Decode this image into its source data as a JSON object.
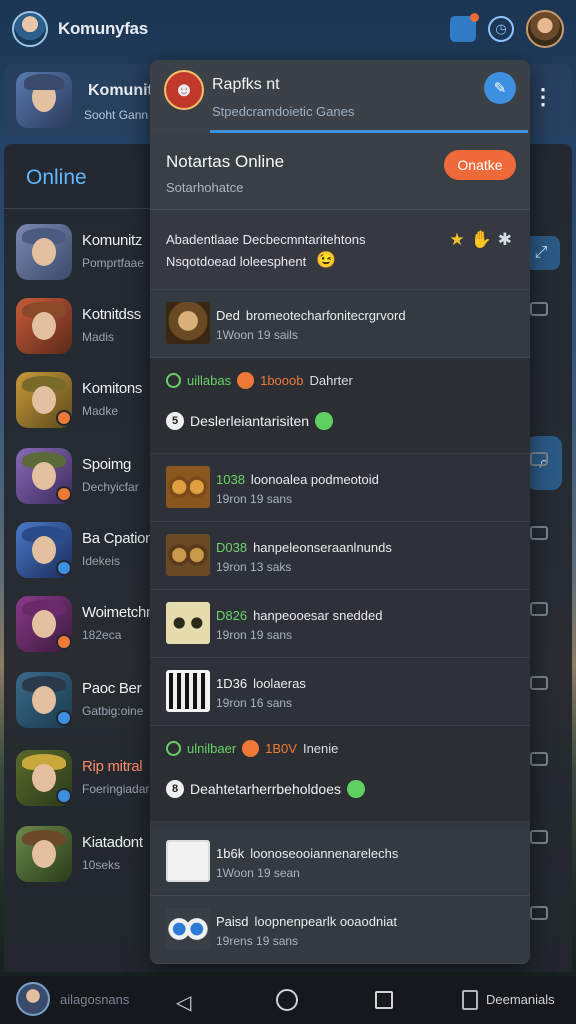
{
  "app": {
    "title": "Komunyfas"
  },
  "community": {
    "title": "Komunit",
    "subtitle": "Sooht Gann"
  },
  "sidebar": {
    "section_label": "Online",
    "items": [
      {
        "name": "Komunitz",
        "sub": "Pomprtfaae"
      },
      {
        "name": "Kotnitdss",
        "sub": "Madis"
      },
      {
        "name": "Komitons",
        "sub": "Madke"
      },
      {
        "name": "Spoimg",
        "sub": "Dechyicfar"
      },
      {
        "name": "Ba Cpation",
        "sub": "Idekeis"
      },
      {
        "name": "Woimetchn",
        "sub": "182eca"
      },
      {
        "name": "Paoc Ber",
        "sub": "Gatbig:oine"
      },
      {
        "name": "Rip mitral",
        "sub": "Foeringiadar"
      },
      {
        "name": "Kiatadont",
        "sub": "10seks"
      }
    ]
  },
  "dropdown": {
    "title": "Rapfks nt",
    "subtitle": "Stpedcramdoietic Ganes",
    "notification": {
      "title": "Notartas Online",
      "subtitle": "Sotarhohatce",
      "button_label": "Onatke"
    },
    "announcement": {
      "line1": "Abadentlaae Decbecmntaritehtons",
      "line2": "Nsqotdoead loleesphent",
      "emoji": "😉"
    },
    "feed": [
      {
        "tag": "Ded",
        "title": "bromeotecharfonitecrgrvord",
        "meta": "1Woon 19 sails",
        "thumb": "a"
      },
      {
        "tag": "1038",
        "title": "loonoalea podmeotoid",
        "meta": "19ron 19 sans",
        "thumb": "b"
      },
      {
        "tag": "D038",
        "title": "hanpeleonseraanlnunds",
        "meta": "19ron 13 saks",
        "thumb": "c"
      },
      {
        "tag": "D826",
        "title": "hanpeooesar snedded",
        "meta": "19ron 19 sans",
        "thumb": "d"
      },
      {
        "tag": "1D36",
        "title": "loolaeras",
        "meta": "19ron 16 sans",
        "thumb": "e"
      },
      {
        "tag": "1b6k",
        "title": "loonoseooiannenarelechs",
        "meta": "1Woon 19 sean",
        "thumb": "f"
      },
      {
        "tag": "Paisd",
        "title": "loopnenpearlk ooaodniat",
        "meta": "19rens 19 sans",
        "thumb": "g"
      }
    ],
    "groups": [
      {
        "status": "uillabas",
        "score": "1booob",
        "label": "Dahrter",
        "num": "5",
        "name": "Deslerleiantarisiten"
      },
      {
        "status": "ulnilbaer",
        "score": "1B0V",
        "label": "Inenie",
        "num": "8",
        "name": "Deahtetarherrbeholdoes"
      }
    ]
  },
  "bottom": {
    "user_label": "ailagosnans",
    "doc_label": "Deemanials"
  },
  "colors": {
    "accent": "#3d8fe0",
    "online_button": "#ef6a3a",
    "status_green": "#67d067"
  }
}
